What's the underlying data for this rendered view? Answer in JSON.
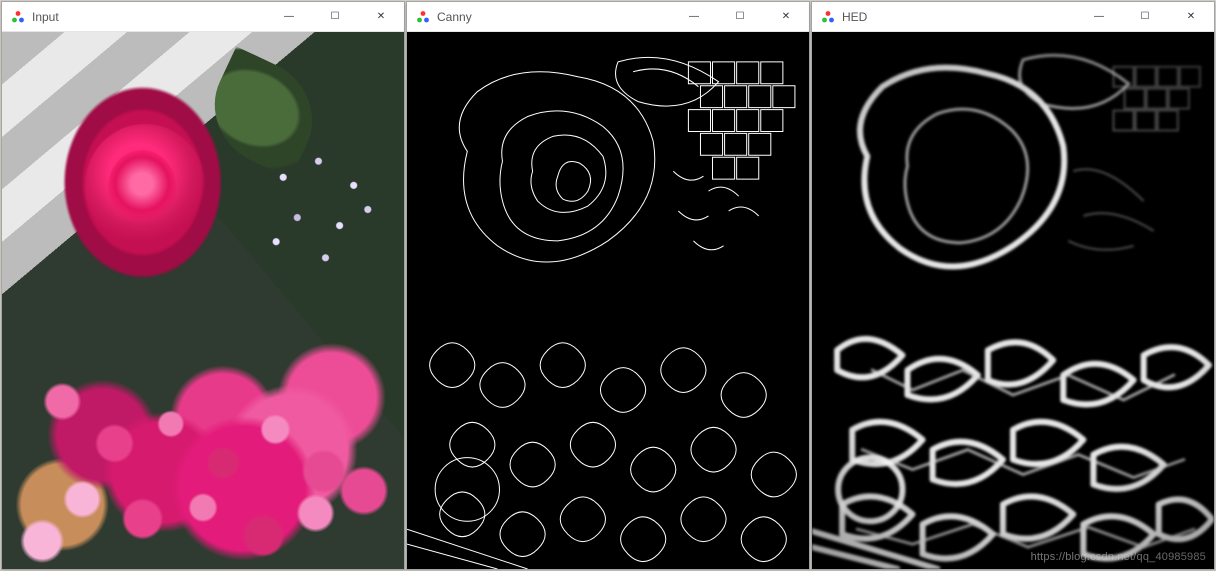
{
  "windows": [
    {
      "title": "Input",
      "icon": "opencv-icon"
    },
    {
      "title": "Canny",
      "icon": "opencv-icon"
    },
    {
      "title": "HED",
      "icon": "opencv-icon"
    }
  ],
  "buttons": {
    "minimize_glyph": "—",
    "maximize_glyph": "☐",
    "close_glyph": "✕"
  },
  "watermark": "https://blog.csdn.net/qq_40985985"
}
